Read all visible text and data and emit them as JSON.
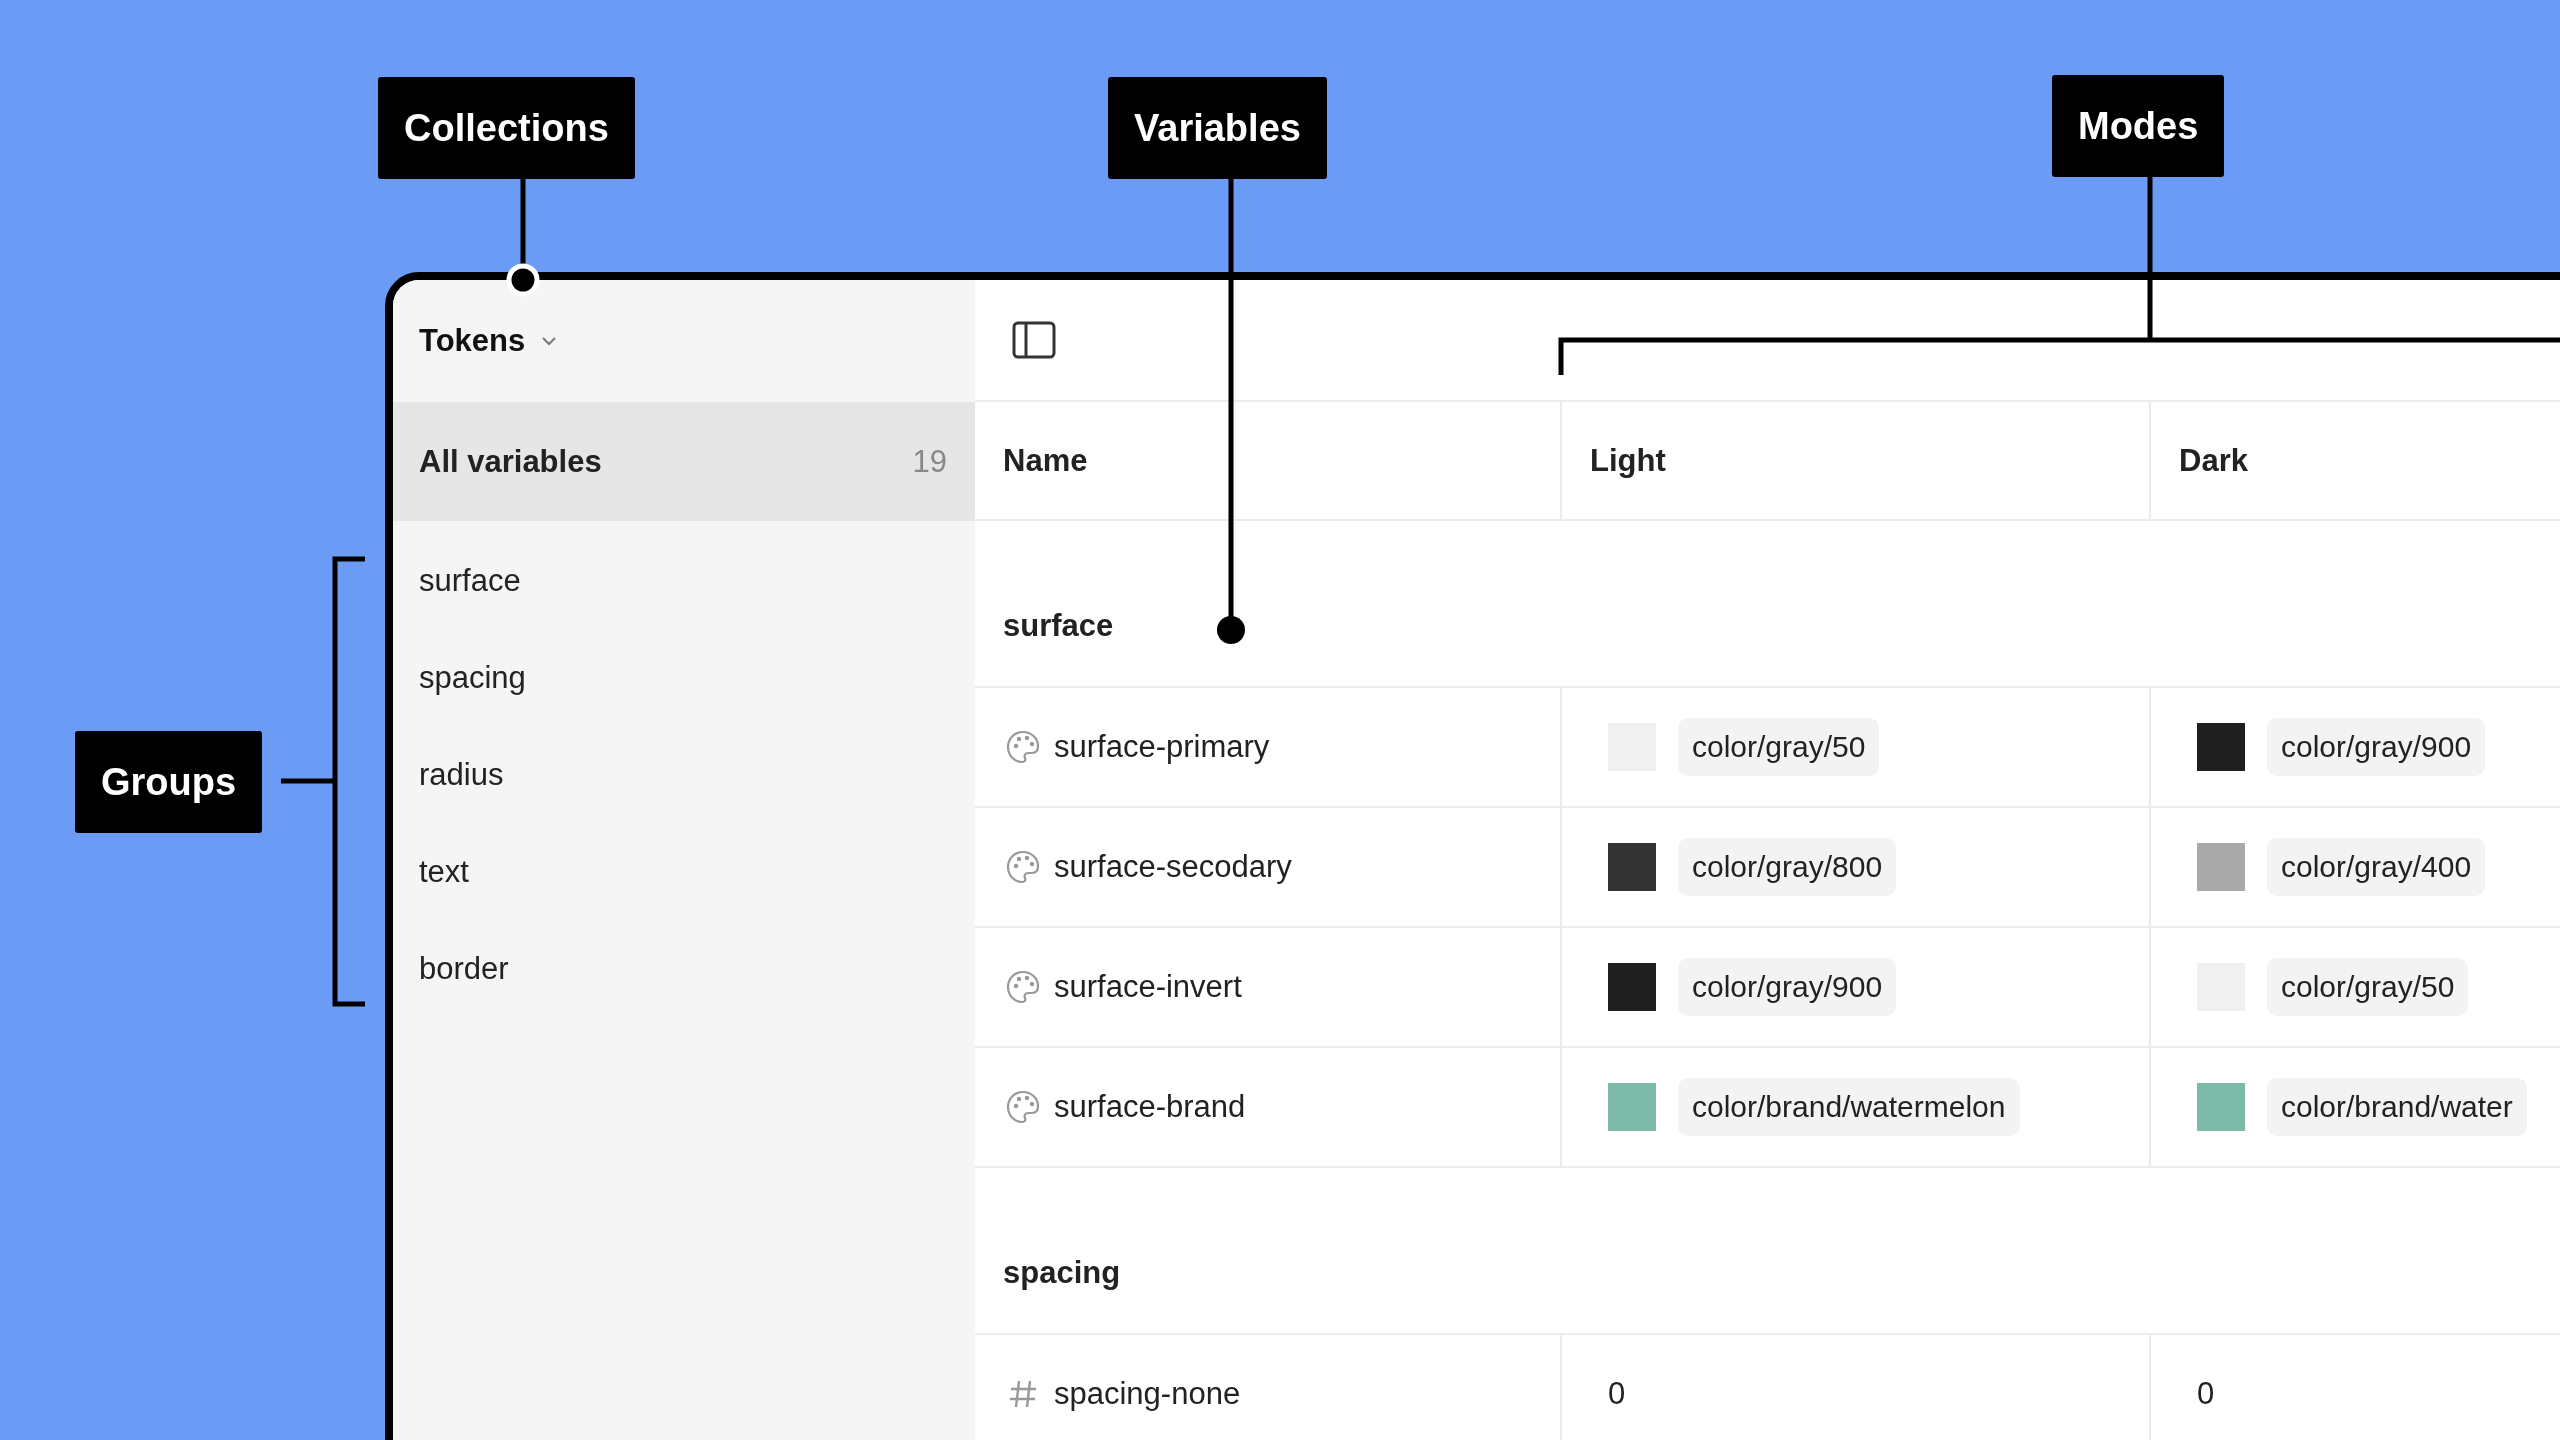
{
  "annotations": [
    {
      "label": "Collections"
    },
    {
      "label": "Variables"
    },
    {
      "label": "Modes"
    },
    {
      "label": "Groups"
    }
  ],
  "collection": {
    "name": "Tokens"
  },
  "sidebar": {
    "items": [
      {
        "label": "All variables",
        "count": "19",
        "selected": true
      },
      {
        "label": "surface",
        "selected": false
      },
      {
        "label": "spacing",
        "selected": false
      },
      {
        "label": "radius",
        "selected": false
      },
      {
        "label": "text",
        "selected": false
      },
      {
        "label": "border",
        "selected": false
      }
    ]
  },
  "table": {
    "columns": [
      "Name",
      "Light",
      "Dark"
    ],
    "groups": [
      {
        "name": "surface",
        "rows": [
          {
            "kind": "color",
            "name": "surface-primary",
            "values": [
              {
                "color": "#f0f0f0",
                "text": "color/gray/50"
              },
              {
                "color": "#1e1e1e",
                "text": "color/gray/900"
              }
            ]
          },
          {
            "kind": "color",
            "name": "surface-secodary",
            "values": [
              {
                "color": "#333333",
                "text": "color/gray/800"
              },
              {
                "color": "#aaaaaa",
                "text": "color/gray/400"
              }
            ]
          },
          {
            "kind": "color",
            "name": "surface-invert",
            "values": [
              {
                "color": "#1e1e1e",
                "text": "color/gray/900"
              },
              {
                "color": "#f0f0f0",
                "text": "color/gray/50"
              }
            ]
          },
          {
            "kind": "color",
            "name": "surface-brand",
            "values": [
              {
                "color": "#7cb9a8",
                "text": "color/brand/watermelon"
              },
              {
                "color": "#7cb9a8",
                "text": "color/brand/water"
              }
            ]
          }
        ]
      },
      {
        "name": "spacing",
        "rows": [
          {
            "kind": "number",
            "name": "spacing-none",
            "values": [
              {
                "text": "0"
              },
              {
                "text": "0"
              }
            ]
          }
        ]
      }
    ]
  }
}
